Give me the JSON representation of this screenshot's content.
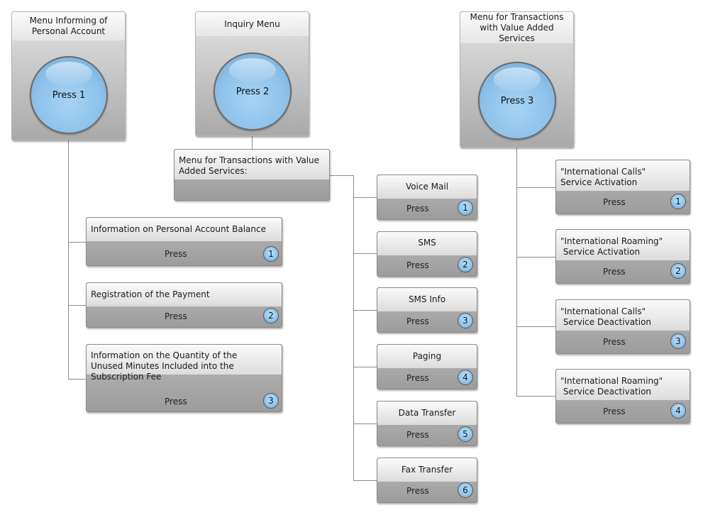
{
  "colors": {
    "connector": "#8c8c8c",
    "button_blue": "#8ec2eb",
    "card_gray": "#a9a9a9"
  },
  "menus": [
    {
      "title": "Menu Informing of Personal Account",
      "button": "Press 1"
    },
    {
      "title": "Inquiry Menu",
      "button": "Press 2"
    },
    {
      "title": "Menu for Transactions with Value Added Services",
      "button": "Press 3"
    }
  ],
  "submenu_header": {
    "title": "Menu for Transactions with Value Added Services:"
  },
  "account_options": [
    {
      "label": "Information on Personal Account Balance",
      "press": "Press",
      "number": "1"
    },
    {
      "label": "Registration of the Payment",
      "press": "Press",
      "number": "2"
    },
    {
      "label": "Information on the Quantity of the Unused Minutes Included into the Subscription Fee",
      "press": "Press",
      "number": "3"
    }
  ],
  "inquiry_options": [
    {
      "label": "Voice Mail",
      "press": "Press",
      "number": "1"
    },
    {
      "label": "SMS",
      "press": "Press",
      "number": "2"
    },
    {
      "label": "SMS Info",
      "press": "Press",
      "number": "3"
    },
    {
      "label": "Paging",
      "press": "Press",
      "number": "4"
    },
    {
      "label": "Data Transfer",
      "press": "Press",
      "number": "5"
    },
    {
      "label": "Fax Transfer",
      "press": "Press",
      "number": "6"
    }
  ],
  "vas_options": [
    {
      "label_line1": "\"International Calls\"",
      "label_line2": "Service Activation",
      "press": "Press",
      "number": "1"
    },
    {
      "label_line1": "\"International Roaming\"",
      "label_line2": " Service Activation",
      "press": "Press",
      "number": "2"
    },
    {
      "label_line1": "\"International Calls\"",
      "label_line2": " Service Deactivation",
      "press": "Press",
      "number": "3"
    },
    {
      "label_line1": "\"International Roaming\"",
      "label_line2": " Service Deactivation",
      "press": "Press",
      "number": "4"
    }
  ]
}
